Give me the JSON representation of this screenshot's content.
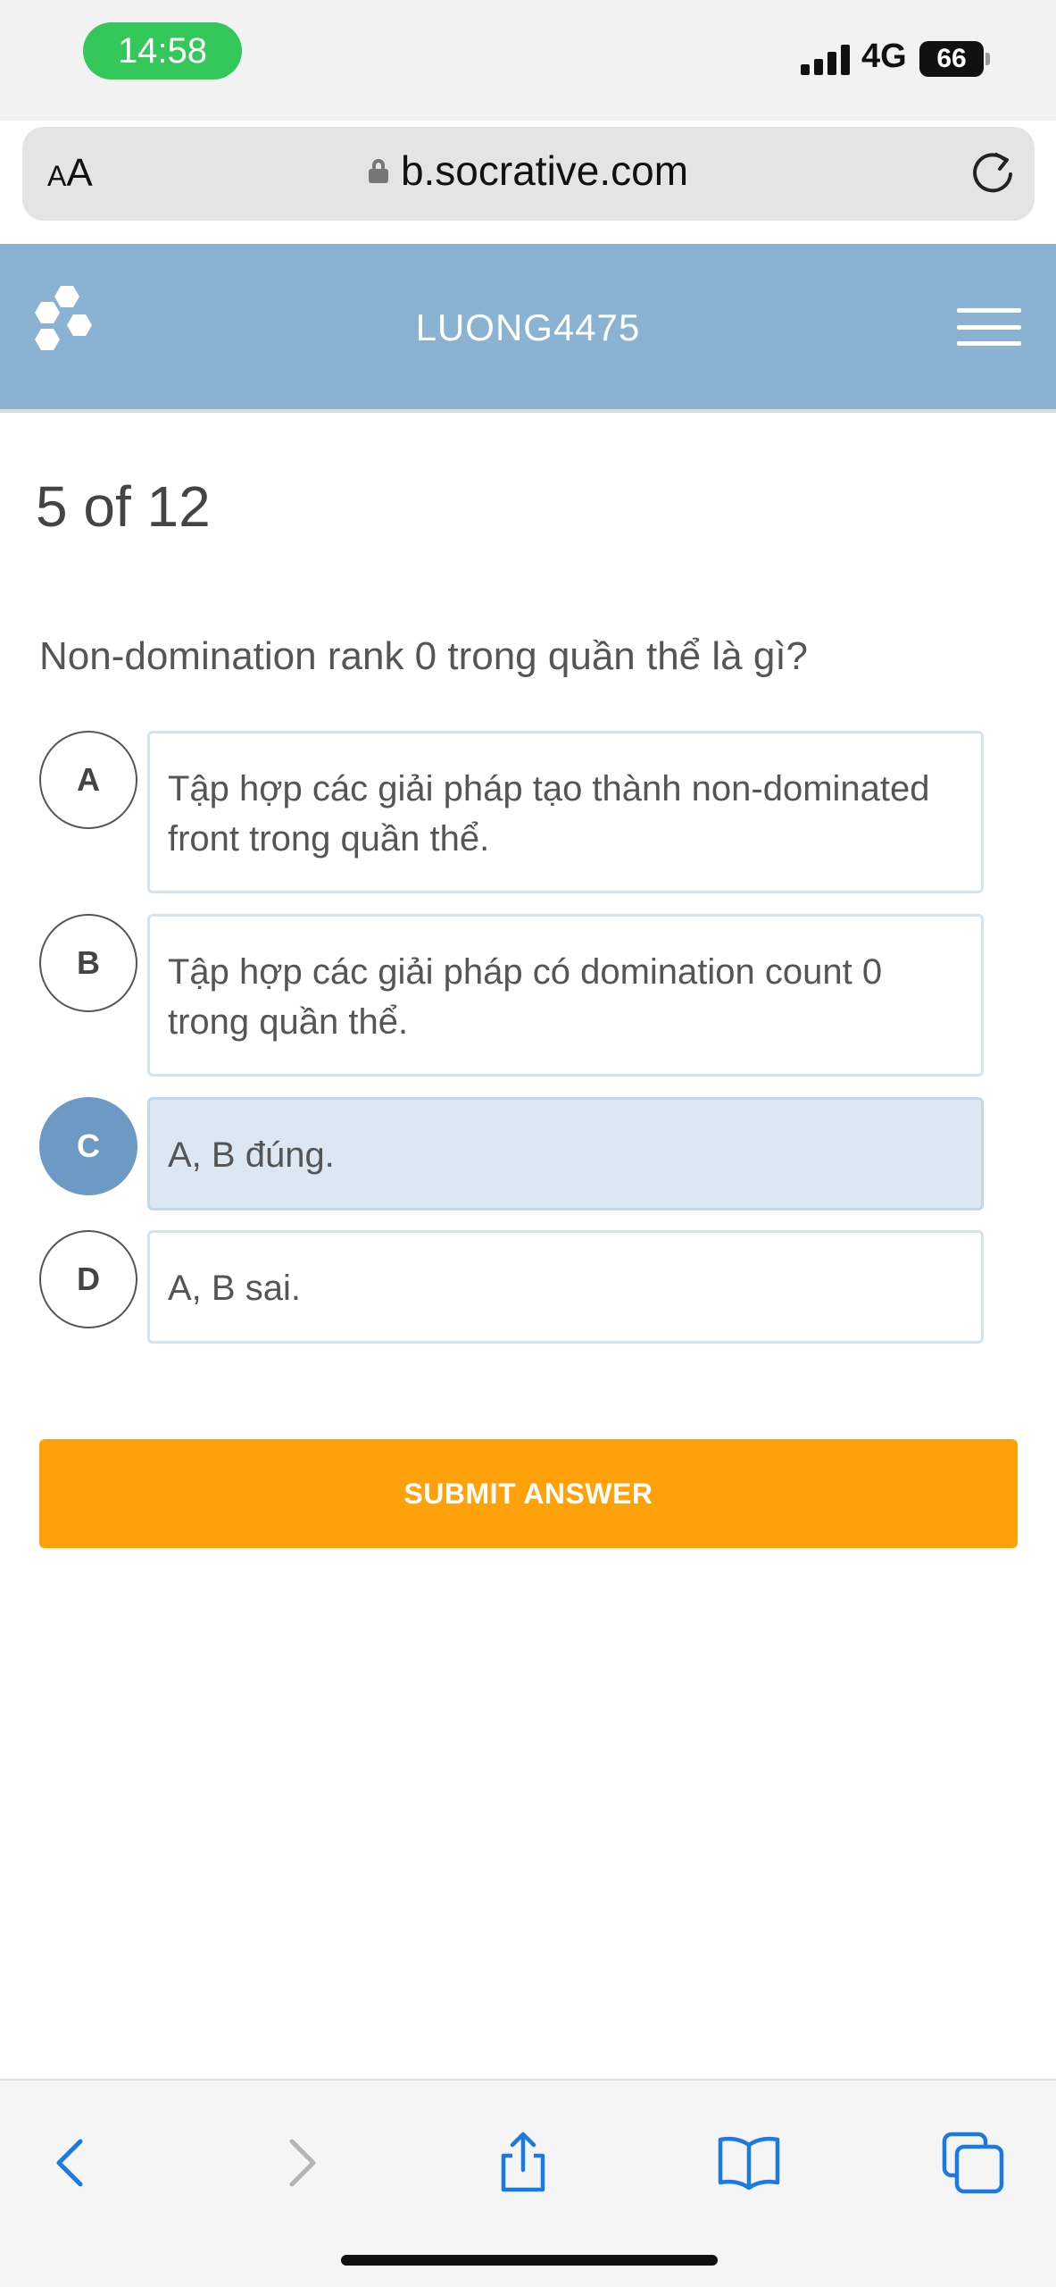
{
  "status_bar": {
    "time": "14:58",
    "network": "4G",
    "battery": "66",
    "signal_bars": 4
  },
  "browser": {
    "text_size_label_small": "A",
    "text_size_label_large": "A",
    "url": "b.socrative.com",
    "lock_icon": "lock-icon",
    "reload_icon": "reload-icon"
  },
  "app_header": {
    "room_name": "LUONG4475",
    "logo_icon": "socrative-hexagon-logo",
    "menu_icon": "hamburger-menu-icon",
    "background_color": "#8ab2d3"
  },
  "quiz": {
    "progress": "5 of 12",
    "question": "Non-domination rank 0 trong quần thể là gì?",
    "selected_option": "C",
    "options": [
      {
        "letter": "A",
        "text": "Tập hợp các giải pháp tạo thành non-dominated front trong quần thể."
      },
      {
        "letter": "B",
        "text": "Tập hợp các giải pháp có domination count 0 trong quần thể."
      },
      {
        "letter": "C",
        "text": "A, B đúng."
      },
      {
        "letter": "D",
        "text": "A, B sai."
      }
    ],
    "submit_label": "SUBMIT ANSWER",
    "submit_color": "#ffa10a",
    "selected_color": "#6d9ac4"
  },
  "toolbar": {
    "icons": [
      "back-icon",
      "forward-icon",
      "share-icon",
      "bookmarks-icon",
      "tabs-icon"
    ],
    "accent_color": "#1a7ae2"
  }
}
